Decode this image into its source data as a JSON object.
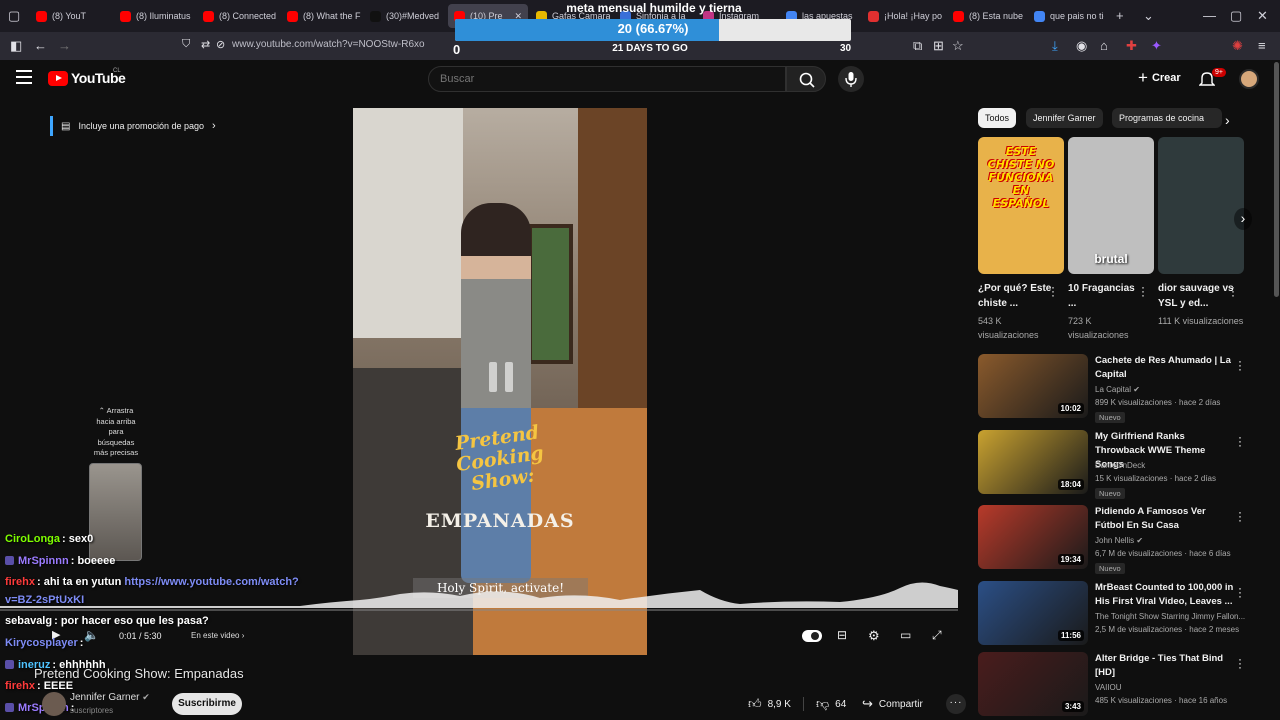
{
  "browser": {
    "tabs": [
      {
        "label": "(8) YouT",
        "color": "#ff0000"
      },
      {
        "label": "(8) Iluminatus",
        "color": "#ff0000"
      },
      {
        "label": "(8) Connected",
        "color": "#ff0000"
      },
      {
        "label": "(8) What the F",
        "color": "#ff0000"
      },
      {
        "label": "(30)#Medved",
        "color": "#111111"
      },
      {
        "label": "(10) Pre",
        "color": "#ff0000",
        "active": true
      },
      {
        "label": "Gafas Camara",
        "color": "#e6b800"
      },
      {
        "label": "Sinfonia a la",
        "color": "#3a6fd8"
      },
      {
        "label": "Instagram",
        "color": "#c13584"
      },
      {
        "label": "las apuestas",
        "color": "#4285f4"
      },
      {
        "label": "¡Hola! ¡Hay po",
        "color": "#e03030"
      },
      {
        "label": "(8) Esta nube",
        "color": "#ff0000"
      },
      {
        "label": "que pais no tie",
        "color": "#4285f4"
      }
    ],
    "url": "www.youtube.com/watch?v=NOOStw-R6xo"
  },
  "goal": {
    "title": "meta mensual humilde y tierna",
    "current_text": "20 (66.67%)",
    "progress": 0.6667,
    "min": "0",
    "max": "30",
    "days_left": "21 DAYS TO GO"
  },
  "youtube": {
    "logo_text": "YouTube",
    "country": "CL",
    "search_placeholder": "Buscar",
    "create_label": "Crear",
    "notifications": "9+",
    "promo": "Incluye una promoción de pago"
  },
  "player": {
    "overlay_title": "Pretend Cooking Show:",
    "overlay_subtitle": "EMPANADAS",
    "caption": "Holy Spirit, activate!",
    "time": "0:01 / 5:30",
    "chapter": "En este video",
    "drag_tip": "Arrastra hacia arriba para búsquedas más precisas"
  },
  "video": {
    "title": "Pretend Cooking Show: Empanadas",
    "channel": "Jennifer Garner",
    "subscribers": "suscriptores",
    "subscribe_label": "Suscribirme",
    "likes": "8,9 K",
    "dislikes": "64",
    "share_label": "Compartir"
  },
  "chat": [
    {
      "user": "CiroLonga",
      "color": "#7fff00",
      "text": "sex0",
      "badge": false
    },
    {
      "user": "MrSpinnn",
      "color": "#9b7bff",
      "text": "boeeee",
      "badge": true
    },
    {
      "user": "firehx",
      "color": "#ff3b3b",
      "text": "ahi ta en yutun ",
      "link": "https://www.youtube.com/watch?",
      "badge": false
    },
    {
      "user": "",
      "color": "#7e8cf5",
      "text": "",
      "link": "v=BZ-2sPtUxKI",
      "badge": false
    },
    {
      "user": "sebavalg",
      "color": "#ffffff",
      "text": "por hacer eso que les pasa?",
      "badge": false
    },
    {
      "user": "Kirycosplayer",
      "color": "#7e8cf5",
      "text": "",
      "badge": false
    },
    {
      "user": "ineruz",
      "color": "#4ec3ff",
      "text": "ehhhhhh",
      "badge": true
    },
    {
      "user": "firehx",
      "color": "#ff3b3b",
      "text": "EEEE",
      "badge": false
    },
    {
      "user": "MrSpinnn",
      "color": "#9b7bff",
      "text": "",
      "badge": true
    }
  ],
  "chips": [
    "Todos",
    "Jennifer Garner",
    "Programas de cocina"
  ],
  "shorts": [
    {
      "title": "¿Por qué? Este chiste ...",
      "views": "543 K visualizaciones",
      "thumb_text": "ESTE CHISTE NO FUNCIONA EN ESPAÑOL",
      "color": "#e8b24a"
    },
    {
      "title": "10 Fragancias ...",
      "views": "723 K visualizaciones",
      "thumb_text": "brutal",
      "color": "#bfbfbf"
    },
    {
      "title": "dior sauvage vs YSL y ed...",
      "views": "111 K visualizaciones",
      "thumb_text": "",
      "color": "#2f3a3c"
    }
  ],
  "recommendations": [
    {
      "title": "Cachete de Res Ahumado | La Capital",
      "channel": "La Capital",
      "meta": "899 K visualizaciones · hace 2 días",
      "duration": "10:02",
      "new": "Nuevo",
      "verified": true,
      "color": "#8a5a2c"
    },
    {
      "title": "My Girlfriend Ranks Throwback WWE Theme Songs",
      "channel": "DanteOnDeck",
      "meta": "15 K visualizaciones · hace 2 días",
      "duration": "18:04",
      "new": "Nuevo",
      "verified": false,
      "color": "#c9a230"
    },
    {
      "title": "Pidiendo A Famosos Ver Fútbol En Su Casa",
      "channel": "John Nellis",
      "meta": "6,7 M de visualizaciones · hace 6 días",
      "duration": "19:34",
      "new": "Nuevo",
      "verified": true,
      "color": "#b83a2a"
    },
    {
      "title": "MrBeast Counted to 100,000 in His First Viral Video, Leaves ...",
      "channel": "The Tonight Show Starring Jimmy Fallon...",
      "meta": "2,5 M de visualizaciones · hace 2 meses",
      "duration": "11:56",
      "new": "",
      "verified": false,
      "color": "#2b4f86"
    },
    {
      "title": "Alter Bridge - Ties That Bind [HD]",
      "channel": "VAIIOU",
      "meta": "485 K visualizaciones · hace 16 años",
      "duration": "3:43",
      "new": "",
      "verified": false,
      "color": "#4a1c1c"
    }
  ]
}
